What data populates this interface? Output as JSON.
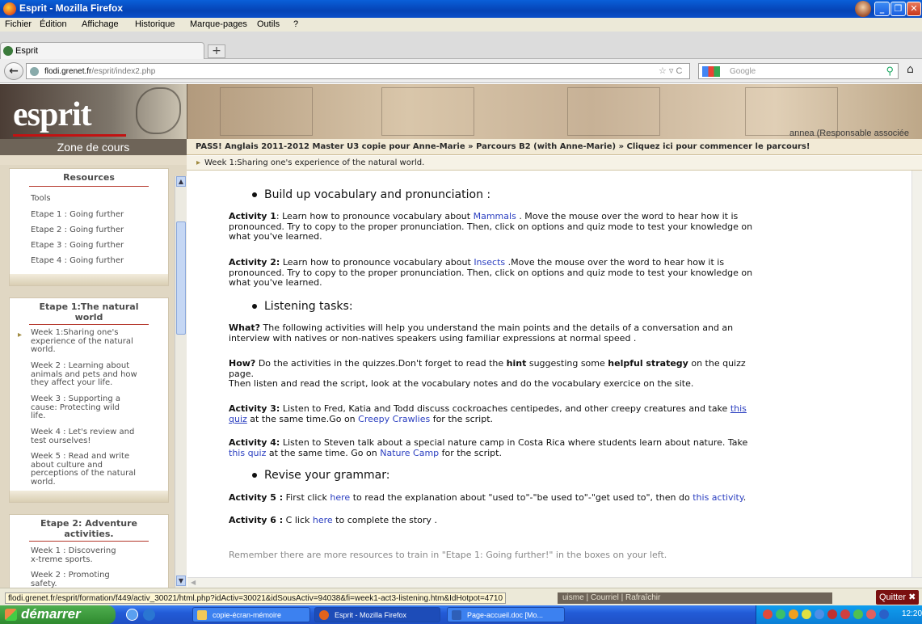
{
  "window": {
    "title": "Esprit - Mozilla Firefox"
  },
  "menu": [
    "Fichier",
    "Édition",
    "Affichage",
    "Historique",
    "Marque-pages",
    "Outils",
    "?"
  ],
  "tab": {
    "label": "Esprit",
    "new_tab": "+"
  },
  "nav": {
    "url_host": "flodi.grenet.fr",
    "url_path": "/esprit/index2.php",
    "search_placeholder": "Google"
  },
  "banner": {
    "logo": "esprit",
    "user": "annea (Responsable associée",
    "zone": "Zone de cours",
    "breadcrumb": "PASS! Anglais 2011-2012 Master U3 copie pour Anne-Marie » Parcours B2 (with Anne-Marie) » Cliquez ici pour commencer le parcours!",
    "subcrumb": "Week 1:Sharing one's experience of the natural world."
  },
  "sidebar": {
    "resources": {
      "title": "Resources",
      "items": [
        "Tools",
        "Etape 1 : Going further",
        "Etape 2 : Going further",
        "Etape 3 : Going further",
        "Etape 4 : Going further"
      ]
    },
    "etape1": {
      "title_1": "Etape 1:The natural",
      "title_2": "world",
      "items": [
        [
          "Week 1:Sharing one's",
          "experience of the natural",
          "world."
        ],
        [
          "Week 2 : Learning about",
          "animals and pets and how",
          "they affect your life."
        ],
        [
          "Week 3 : Supporting a",
          "cause: Protecting wild",
          "life."
        ],
        [
          "Week 4 : Let's review and",
          "test ourselves!"
        ],
        [
          "Week 5 : Read and write",
          "about culture and",
          "perceptions of the natural",
          "world."
        ]
      ]
    },
    "etape2": {
      "title_1": "Etape 2: Adventure",
      "title_2": "activities.",
      "items": [
        [
          "Week 1 : Discovering",
          "x-treme sports."
        ],
        [
          "Week 2 : Promoting",
          "safety."
        ]
      ]
    }
  },
  "content": {
    "h_vocab": "Build up vocabulary and pronunciation :",
    "a1": {
      "label": "Activity 1",
      "pre": ": Learn how to pronounce  vocabulary about",
      "link": "Mammals",
      "line1_post": ". Move the mouse over the word to hear how it is",
      "line2": "pronounced. Try to copy to the proper pronunciation.  Then, click on options and quiz mode to test your knowledge on",
      "line3": "what you've learned."
    },
    "a2": {
      "label": "Activity 2:",
      "pre": "Learn how to pronounce  vocabulary about",
      "link": "Insects",
      "line1_post": ".Move the mouse over the word to hear how it is",
      "line2": "pronounced. Try to copy to the proper pronunciation.   Then, click on options and quiz mode to test your knowledge on",
      "line3": "what you've learned."
    },
    "h_listen": "Listening tasks:",
    "what": {
      "label": "What?",
      "line1": "The following activities will help you understand the main points and the details of a conversation and an",
      "line2": "interview with natives or non-natives speakers using familiar expressions at normal speed ."
    },
    "how": {
      "label": "How?",
      "pre": "Do the activities in the quizzes.Don't forget to read the",
      "hint": "hint",
      "mid": "suggesting some",
      "strategy": "helpful strategy",
      "post": "on the quizz",
      "line2": "page.",
      "line3": "Then listen and read the script, look at the vocabulary notes and do the vocabulary exercice on the site."
    },
    "a3": {
      "label": "Activity 3:",
      "pre": "Listen to Fred, Katia and Todd discuss cockroaches centipedes, and other creepy creatures and take",
      "link_this": "this",
      "link_quiz": "quiz",
      "mid": "at the same time.Go on",
      "link_script": "Creepy Crawlies",
      "post": "for the script."
    },
    "a4": {
      "label": "Activity 4:",
      "pre": "Listen to Steven talk about a special nature camp in Costa Rica where students learn about nature. Take",
      "link_quiz": "this quiz",
      "mid": "at the same time. Go on",
      "link_script": "Nature Camp",
      "post": "for the script."
    },
    "h_grammar": "Revise your grammar:",
    "a5": {
      "label": "Activity 5 :",
      "pre": "First click",
      "link_here": "here",
      "mid": "to  read the explanation about \"used to\"-\"be used to\"-\"get used to\", then do",
      "link_act": "this activity",
      "post": "."
    },
    "a6": {
      "label": "Activity 6 :",
      "pre": "C lick",
      "link_here": "here",
      "post": "to complete the story  ."
    },
    "remember": "Remember there are more resources to train in \"Etape 1: Going further!\" in the boxes on your left."
  },
  "status": {
    "url": "flodi.grenet.fr/esprit/formation/f449/activ_30021/html.php?idActiv=30021&idSousActiv=94038&fi=week1-act3-listening.htm&IdHotpot=4710",
    "footer_links": "uisme  |  Courriel  |  Rafraîchir",
    "quit": "Quitter"
  },
  "taskbar": {
    "start": "démarrer",
    "tasks": [
      "copie-écran-mémoire",
      "Esprit - Mozilla Firefox",
      "Page-accueil.doc [Mo..."
    ],
    "clock": "12:20"
  }
}
